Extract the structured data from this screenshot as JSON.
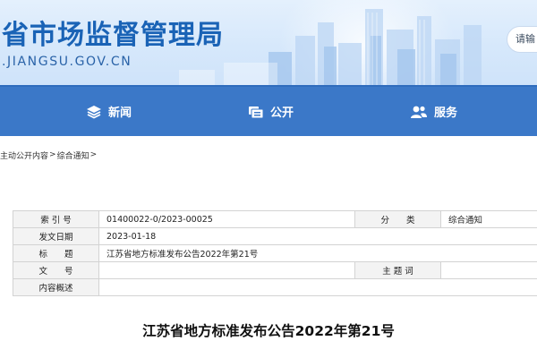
{
  "header": {
    "site_title": "省市场监督管理局",
    "site_domain": ".JIANGSU.GOV.CN",
    "login_button_label": "请输"
  },
  "nav": {
    "items": [
      {
        "label": "新闻",
        "icon": "layers-icon"
      },
      {
        "label": "公开",
        "icon": "folder-stack-icon"
      },
      {
        "label": "服务",
        "icon": "users-icon"
      }
    ]
  },
  "breadcrumb": {
    "items": [
      "主动公开内容",
      "综合通知"
    ],
    "separator": ">",
    "trailing_separator": ">"
  },
  "meta": {
    "index_label": "索 引 号",
    "index_value": "01400022-0/2023-00025",
    "category_label": "分　　类",
    "category_value": "综合通知",
    "date_label": "发文日期",
    "date_value": "2023-01-18",
    "title_label": "标　　题",
    "title_value": "江苏省地方标准发布公告2022年第21号",
    "docno_label": "文　　号",
    "docno_value": "",
    "subject_label": "主 题 词",
    "subject_value": "",
    "summary_label": "内容概述",
    "summary_value": ""
  },
  "article": {
    "title": "江苏省地方标准发布公告2022年第21号"
  },
  "colors": {
    "nav_background": "#3b78c8",
    "title_blue": "#1a63b6",
    "banner_light": "#e4f0fd"
  }
}
